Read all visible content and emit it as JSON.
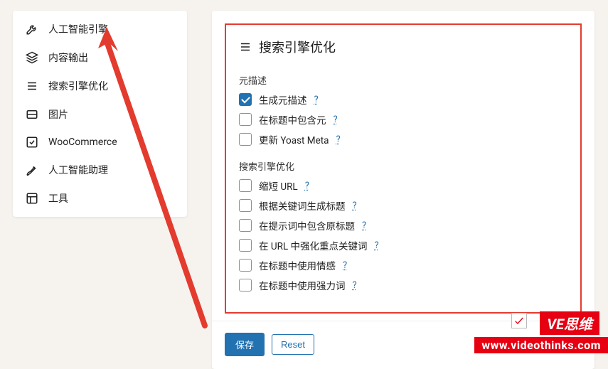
{
  "sidebar": {
    "items": [
      {
        "label": "人工智能引擎",
        "icon": "wrench"
      },
      {
        "label": "内容输出",
        "icon": "layers"
      },
      {
        "label": "搜索引擎优化",
        "icon": "list"
      },
      {
        "label": "图片",
        "icon": "image"
      },
      {
        "label": "WooCommerce",
        "icon": "check-square"
      },
      {
        "label": "人工智能助理",
        "icon": "pen"
      },
      {
        "label": "工具",
        "icon": "layout"
      }
    ]
  },
  "panel": {
    "title": "搜索引擎优化",
    "help_char": "?",
    "groups": [
      {
        "label": "元描述",
        "items": [
          {
            "label": "生成元描述",
            "checked": true
          },
          {
            "label": "在标题中包含元",
            "checked": false
          },
          {
            "label": "更新 Yoast Meta",
            "checked": false
          }
        ]
      },
      {
        "label": "搜索引擎优化",
        "items": [
          {
            "label": "缩短 URL",
            "checked": false
          },
          {
            "label": "根据关键词生成标题",
            "checked": false
          },
          {
            "label": "在提示词中包含原标题",
            "checked": false
          },
          {
            "label": "在 URL 中强化重点关键词",
            "checked": false
          },
          {
            "label": "在标题中使用情感",
            "checked": false
          },
          {
            "label": "在标题中使用强力词",
            "checked": false
          }
        ]
      }
    ],
    "save_label": "保存",
    "reset_label": "Reset"
  },
  "watermark": {
    "brand": "VE思维",
    "url": "www.videothinks.com"
  }
}
